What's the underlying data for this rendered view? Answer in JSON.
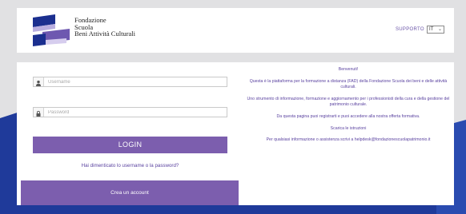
{
  "brand": {
    "line1": "Fondazione",
    "line2": "Scuola",
    "line3": "Beni Attività Culturali",
    "logo_icon": "fondazione-logo",
    "colors": {
      "navy": "#1b2f8f",
      "purple": "#6e58b0",
      "lavender": "#b9aee0"
    }
  },
  "header": {
    "support_label": "SUPPORTO",
    "language_value": "IT"
  },
  "login": {
    "username_placeholder": "Username",
    "password_placeholder": "Password",
    "username_icon": "user-icon",
    "password_icon": "lock-icon",
    "login_label": "LOGIN",
    "forgot_label": "Hai dimenticato lo username o la password?",
    "create_account_label": "Crea un account"
  },
  "info": {
    "welcome": "Benvenuti!",
    "p1": "Questa è la piattaforma per la formazione a distanza (FAD) della Fondazione Scuola dei beni e delle attività culturali.",
    "p2": "Uno strumento di informazione, formazione e aggiornamento per i professionisti della cura e della gestione del patrimonio culturale.",
    "p3": "Da questa pagina puoi registrarti e puoi accedere alla nostra offerta formativa.",
    "p4": "Scarica le istruzioni",
    "p5": "Per qualsiasi informazione o assistenza scrivi a helpdesk@fondazionescuolapatrimonio.it"
  },
  "theme": {
    "accent": "#7c5eae",
    "background": "#e1e1e3",
    "decor_blue": "#1f3a9a"
  }
}
